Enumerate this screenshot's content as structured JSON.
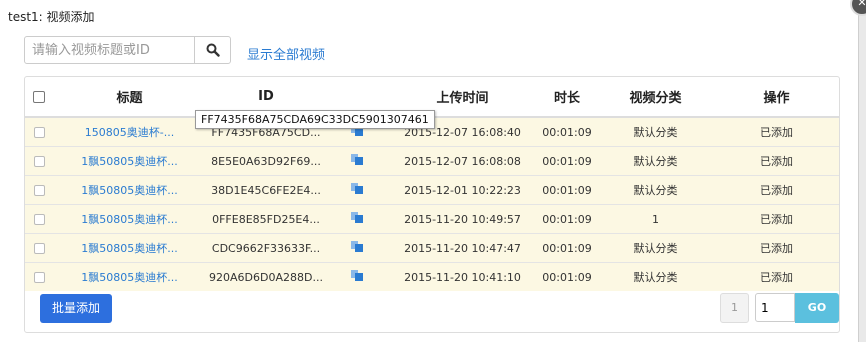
{
  "dialog": {
    "title": "test1: 视频添加"
  },
  "search": {
    "placeholder": "请输入视频标题或ID",
    "value": "",
    "show_all_label": "显示全部视频"
  },
  "table": {
    "headers": {
      "title": "标题",
      "id": "ID",
      "upload_time": "上传时间",
      "duration": "时长",
      "category": "视频分类",
      "action": "操作"
    },
    "rows": [
      {
        "title": "150805奥迪杯-...",
        "id": "FF7435F68A75CD...",
        "upload_time": "2015-12-07 16:08:40",
        "duration": "00:01:09",
        "category": "默认分类",
        "action": "已添加"
      },
      {
        "title": "1飘50805奥迪杯...",
        "id": "8E5E0A63D92F69...",
        "upload_time": "2015-12-07 16:08:08",
        "duration": "00:01:09",
        "category": "默认分类",
        "action": "已添加"
      },
      {
        "title": "1飘50805奥迪杯...",
        "id": "38D1E45C6FE2E4...",
        "upload_time": "2015-12-01 10:22:23",
        "duration": "00:01:09",
        "category": "默认分类",
        "action": "已添加"
      },
      {
        "title": "1飘50805奥迪杯...",
        "id": "0FFE8E85FD25E4...",
        "upload_time": "2015-11-20 10:49:57",
        "duration": "00:01:09",
        "category": "1",
        "action": "已添加"
      },
      {
        "title": "1飘50805奥迪杯...",
        "id": "CDC9662F33633F...",
        "upload_time": "2015-11-20 10:47:47",
        "duration": "00:01:09",
        "category": "默认分类",
        "action": "已添加"
      },
      {
        "title": "1飘50805奥迪杯...",
        "id": "920A6D6D0A288D...",
        "upload_time": "2015-11-20 10:41:10",
        "duration": "00:01:09",
        "category": "默认分类",
        "action": "已添加"
      }
    ]
  },
  "tooltip": {
    "text": "FF7435F68A75CDA69C33DC5901307461"
  },
  "footer": {
    "batch_add_label": "批量添加",
    "prev_page_label": "1",
    "page_value": "1",
    "go_label": "GO"
  },
  "icons": {
    "search": "search-icon",
    "copy": "copy-icon",
    "close": "close-icon"
  },
  "colors": {
    "link": "#2a7bd1",
    "row_highlight": "#fcf8e3",
    "primary_button": "#2d6fde",
    "go_button": "#5bc0de"
  }
}
